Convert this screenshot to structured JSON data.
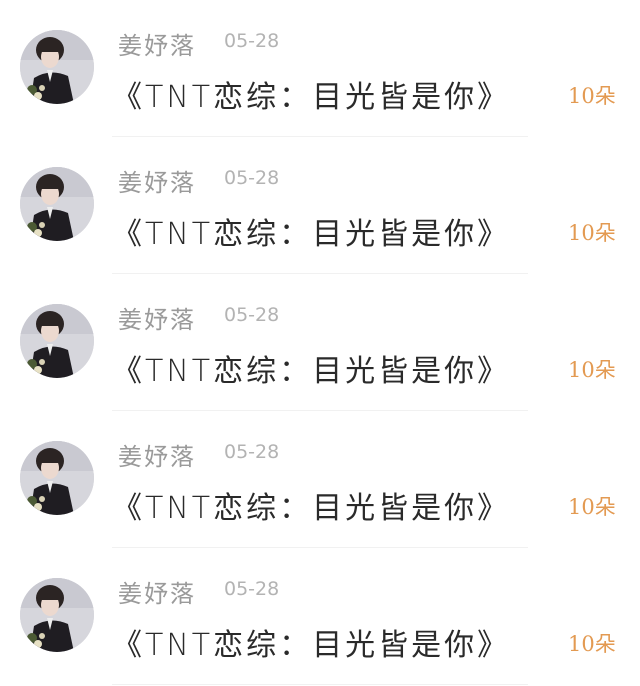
{
  "comments": [
    {
      "author": "姜妤落",
      "date": "05-28",
      "text": "《TNT恋综：目光皆是你》",
      "gift": "10朵"
    },
    {
      "author": "姜妤落",
      "date": "05-28",
      "text": "《TNT恋综：目光皆是你》",
      "gift": "10朵"
    },
    {
      "author": "姜妤落",
      "date": "05-28",
      "text": "《TNT恋综：目光皆是你》",
      "gift": "10朵"
    },
    {
      "author": "姜妤落",
      "date": "05-28",
      "text": "《TNT恋综：目光皆是你》",
      "gift": "10朵"
    },
    {
      "author": "姜妤落",
      "date": "05-28",
      "text": "《TNT恋综：目光皆是你》",
      "gift": "10朵"
    }
  ],
  "colors": {
    "author": "#9a9a9a",
    "date": "#b3b3b3",
    "text": "#2a2a2a",
    "gift": "#e39a52"
  }
}
